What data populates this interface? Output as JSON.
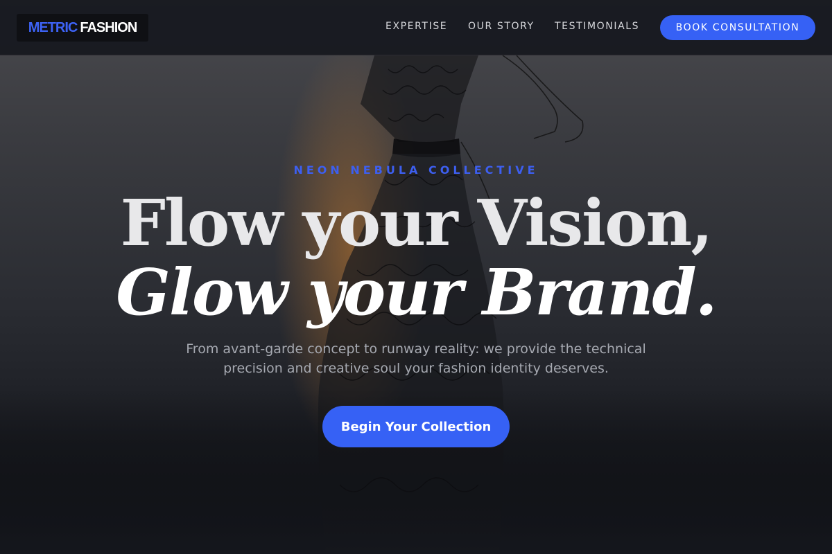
{
  "nav": {
    "logo_part1": "METRIC",
    "logo_part2": "FASHION",
    "links": [
      "EXPERTISE",
      "OUR STORY",
      "TESTIMONIALS"
    ],
    "cta_label": "BOOK CONSULTATION"
  },
  "hero": {
    "eyebrow": "NEON NEBULA COLLECTIVE",
    "headline_line1": "Flow your Vision,",
    "headline_line2": "Glow your Brand.",
    "subtitle": "From avant-garde concept to runway reality: we provide the technical precision and creative soul your fashion identity deserves.",
    "cta_label": "Begin Your Collection"
  },
  "colors": {
    "accent": "#3661f5",
    "eyebrow": "#3d5ff0",
    "background": "#15171d"
  }
}
